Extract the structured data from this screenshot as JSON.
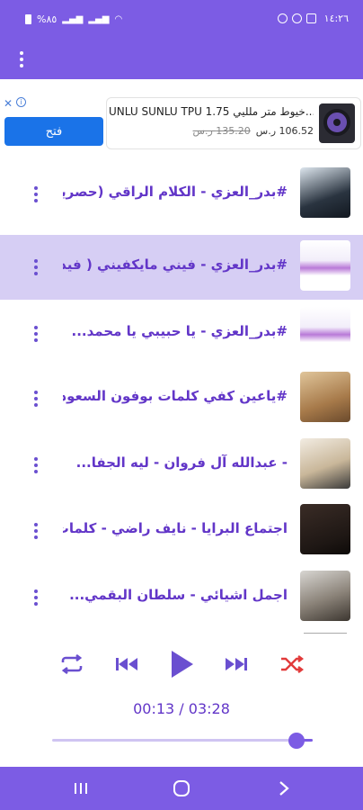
{
  "status_bar": {
    "time": "١٤:٢٦",
    "battery": "%٨٥"
  },
  "app_bar": {
    "menu_icon": "overflow-menu-icon"
  },
  "ad": {
    "title": "UNLU SUNLU TPU 1.75 خيوط متر ملليي...",
    "price": "106.52 ر.س",
    "old_price": "135.20 ر.س",
    "open_label": "فتح"
  },
  "tracks": [
    {
      "title": "#بدر_العزي - الكلام الراقي (حصرياً)...",
      "active": false
    },
    {
      "title": "#بدر_العزي - فيني مايكفيني ( فيدي...",
      "active": true
    },
    {
      "title": "#بدر_العزي - يا حبيبي يا محمد...",
      "active": false
    },
    {
      "title": "#ياعين كفي كلمات بوفون السعودي...",
      "active": false
    },
    {
      "title": "- عبدالله آل فروان - ليه الجفا...",
      "active": false
    },
    {
      "title": "اجتماع البرايا - نايف راضي - كلمات:...",
      "active": false
    },
    {
      "title": "اجمل اشيائي - سلطان البقمي...",
      "active": false
    }
  ],
  "player": {
    "time_display": "00:13 / 03:28",
    "progress": 0.063,
    "accent_color": "#7c5ce4",
    "shuffle_color": "#e23b3b"
  }
}
